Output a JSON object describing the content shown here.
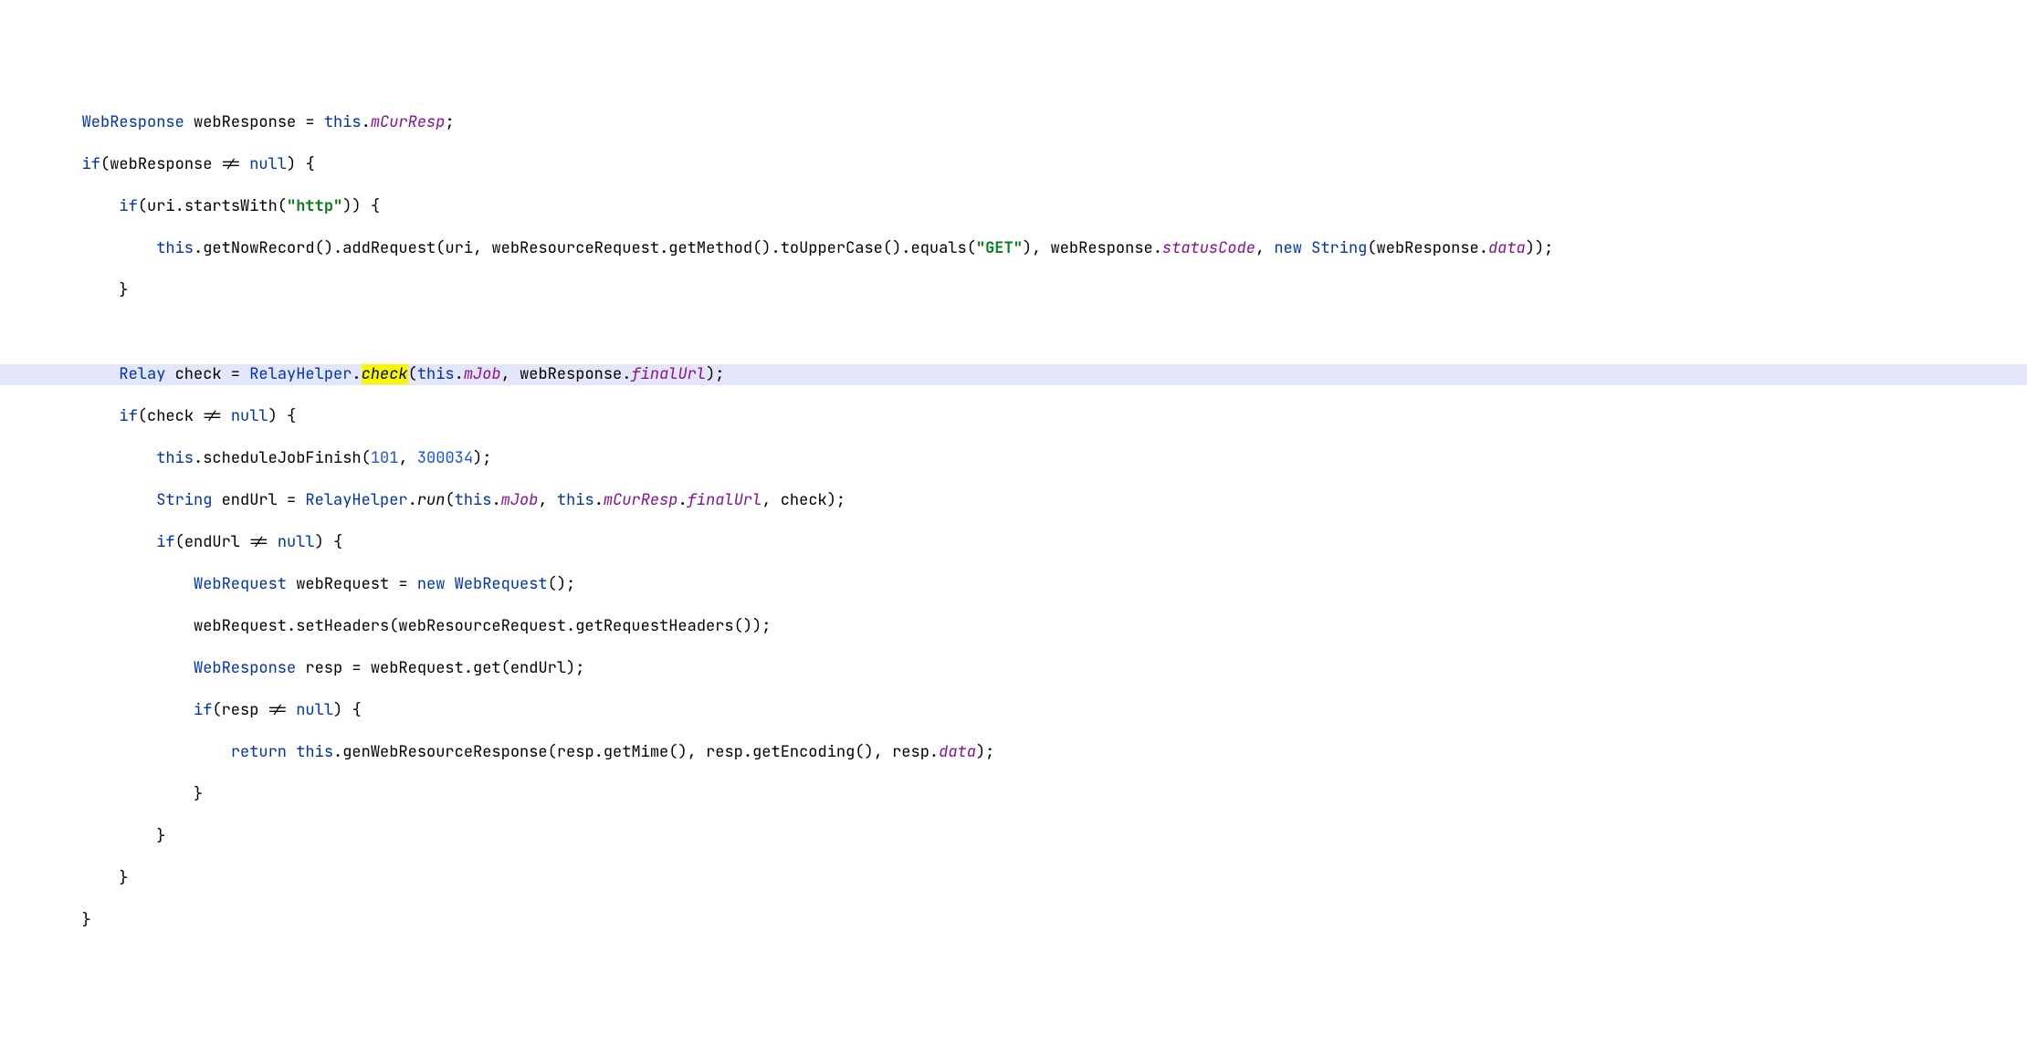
{
  "code": {
    "types": {
      "WebResponse": "WebResponse",
      "Relay": "Relay",
      "String": "String",
      "WebRequest": "WebRequest"
    },
    "keywords": {
      "if": "if",
      "this": "this",
      "null": "null",
      "new": "new",
      "return": "return"
    },
    "vars": {
      "webResponse": "webResponse",
      "uri": "uri",
      "webResourceRequest": "webResourceRequest",
      "check": "check",
      "endUrl": "endUrl",
      "webRequest": "webRequest",
      "resp": "resp"
    },
    "fields": {
      "mCurResp": "mCurResp",
      "mJob": "mJob",
      "finalUrl": "finalUrl",
      "statusCode": "statusCode",
      "data": "data"
    },
    "classes": {
      "RelayHelper": "RelayHelper"
    },
    "methods": {
      "startsWith": "startsWith",
      "getNowRecord": "getNowRecord",
      "addRequest": "addRequest",
      "getMethod": "getMethod",
      "toUpperCase": "toUpperCase",
      "equals": "equals",
      "check": "check",
      "scheduleJobFinish": "scheduleJobFinish",
      "run": "run",
      "setHeaders": "setHeaders",
      "getRequestHeaders": "getRequestHeaders",
      "get": "get",
      "genWebResourceResponse": "genWebResourceResponse",
      "getMime": "getMime",
      "getEncoding": "getEncoding"
    },
    "strings": {
      "http": "\"http\"",
      "GET": "\"GET\""
    },
    "numbers": {
      "n101": "101",
      "n300034": "300034"
    }
  }
}
